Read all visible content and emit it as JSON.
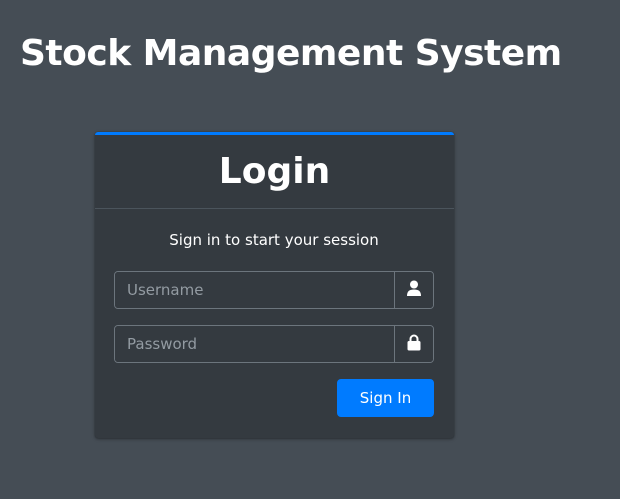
{
  "app": {
    "title": "Stock Management System"
  },
  "login": {
    "header": "Login",
    "message": "Sign in to start your session",
    "username": {
      "placeholder": "Username",
      "value": "",
      "icon": "user-icon"
    },
    "password": {
      "placeholder": "Password",
      "value": "",
      "icon": "lock-icon"
    },
    "submit_label": "Sign In"
  },
  "colors": {
    "background": "#454d55",
    "card": "#343a40",
    "accent": "#007bff"
  }
}
